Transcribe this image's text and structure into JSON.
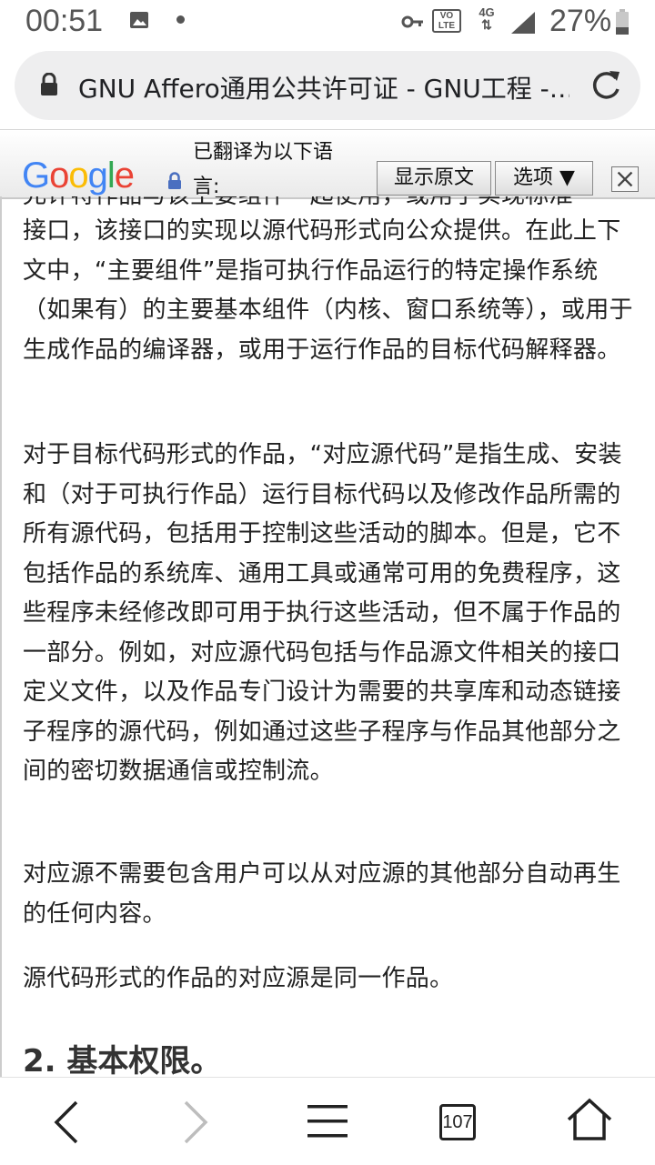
{
  "status_bar": {
    "time": "00:51",
    "volte_line1": "VO",
    "volte_line2": "LTE",
    "network": "4G",
    "battery": "27%",
    "icons": [
      "image-icon",
      "notification-dot-icon",
      "key-icon",
      "volte-icon",
      "data-arrows-icon",
      "signal-icon",
      "battery-icon"
    ]
  },
  "browser": {
    "url_title": "GNU Affero通用公共许可证 - GNU工程 -…",
    "icons": [
      "lock-icon",
      "reload-icon"
    ]
  },
  "translate_bar": {
    "logo": [
      "G",
      "o",
      "o",
      "g",
      "l",
      "e"
    ],
    "logo_colors": [
      "#4285F4",
      "#EA4335",
      "#FBBC05",
      "#4285F4",
      "#34A853",
      "#EA4335"
    ],
    "message_line1": "已翻译为以下语",
    "message_line2": "言:",
    "show_original": "显示原文",
    "options": "选项 ▼",
    "icons": [
      "lock-icon",
      "close-icon"
    ]
  },
  "content": {
    "cut_line": "允许特作品与该主要组件一起使用，或用于实现标准",
    "paragraphs": [
      "接口，该接口的实现以源代码形式向公众提供。在此上下文中，“主要组件”是指可执行作品运行的特定操作系统（如果有）的主要基本组件（内核、窗口系统等），或用于生成作品的编译器，或用于运行作品的目标代码解释器。",
      "对于目标代码形式的作品，“对应源代码”是指生成、安装和（对于可执行作品）运行目标代码以及修改作品所需的所有源代码，包括用于控制这些活动的脚本。但是，它不包括作品的系统库、通用工具或通常可用的免费程序，这些程序未经修改即可用于执行这些活动，但不属于作品的一部分。例如，对应源代码包括与作品源文件相关的接口定义文件，以及作品专门设计为需要的共享库和动态链接子程序的源代码，例如通过这些子程序与作品其他部分之间的密切数据通信或控制流。",
      "对应源不需要包含用户可以从对应源的其他部分自动再生的任何内容。",
      "源代码形式的作品的对应源是同一作品。"
    ],
    "heading": "2. 基本权限。"
  },
  "bottom_nav": {
    "tab_count": "107",
    "icons": [
      "back-icon",
      "forward-icon",
      "menu-icon",
      "tabs-icon",
      "home-icon"
    ]
  }
}
